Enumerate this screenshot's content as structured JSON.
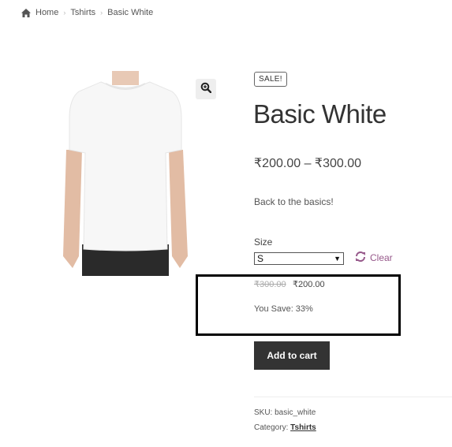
{
  "breadcrumb": {
    "items": [
      "Home",
      "Tshirts",
      "Basic White"
    ],
    "home_icon": "home-icon",
    "separator_icon": "chevron-right-icon"
  },
  "product": {
    "badge": "SALE!",
    "title": "Basic White",
    "price_range": "₹200.00 – ₹300.00",
    "short_description": "Back to the basics!",
    "image_alt": "White t-shirt worn by model"
  },
  "gallery": {
    "zoom_icon": "magnify-plus-icon"
  },
  "variation": {
    "label": "Size",
    "selected": "S",
    "clear_label": "Clear",
    "clear_icon": "refresh-icon"
  },
  "variation_price": {
    "regular": "₹300.00",
    "sale": "₹200.00",
    "savings": "You Save: 33%"
  },
  "cart": {
    "add_label": "Add to cart"
  },
  "meta": {
    "sku": "SKU: basic_white",
    "category_label": "Category: ",
    "category_value": "Tshirts"
  },
  "colors": {
    "accent": "#96588a",
    "button": "#333333"
  }
}
